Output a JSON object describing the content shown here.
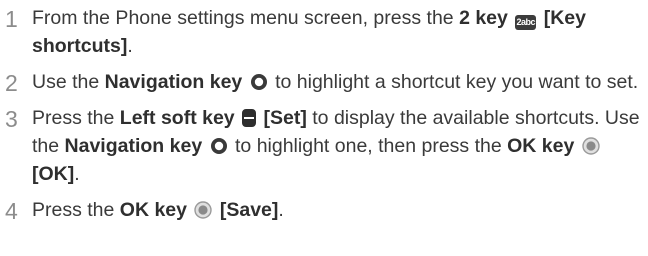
{
  "steps": [
    {
      "number": "1",
      "t1": "From the Phone settings menu screen, press the ",
      "b1": "2 key",
      "key_label": "2abc",
      "b2": "[Key shortcuts]",
      "t2": "."
    },
    {
      "number": "2",
      "t1": "Use the ",
      "b1": "Navigation key",
      "t2": " to highlight a shortcut key you want to set."
    },
    {
      "number": "3",
      "t1": "Press the ",
      "b1": "Left soft key",
      "b2": "[Set]",
      "t2": " to display the available shortcuts. Use the ",
      "b3": "Navigation key",
      "t3": " to highlight one, then press the ",
      "b4": "OK key",
      "b5": "[OK]",
      "t4": "."
    },
    {
      "number": "4",
      "t1": "Press the ",
      "b1": "OK key",
      "b2": "[Save]",
      "t2": "."
    }
  ],
  "icons": {
    "two_key": "two-key-icon",
    "navigation_key": "navigation-key-icon",
    "left_soft_key": "left-soft-key-icon",
    "ok_key": "ok-key-icon"
  }
}
